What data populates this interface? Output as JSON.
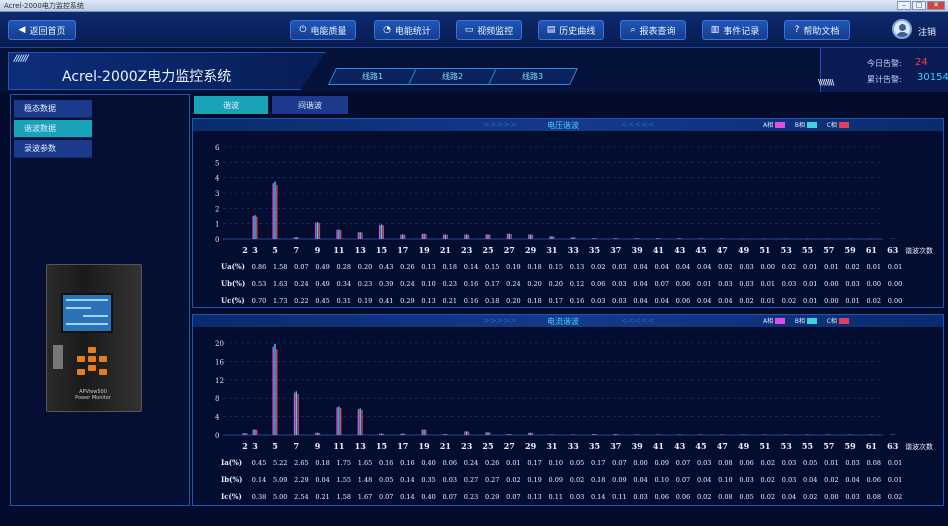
{
  "window": {
    "title": "Acrel-2000电力监控系统"
  },
  "nav": {
    "home": "返回首页",
    "items": [
      {
        "label": "电能质量",
        "icon": "power-quality-icon"
      },
      {
        "label": "电能统计",
        "icon": "statistics-icon"
      },
      {
        "label": "视频监控",
        "icon": "video-icon"
      },
      {
        "label": "历史曲线",
        "icon": "history-curve-icon"
      },
      {
        "label": "报表查询",
        "icon": "report-search-icon"
      },
      {
        "label": "事件记录",
        "icon": "event-record-icon"
      },
      {
        "label": "帮助文档",
        "icon": "help-icon"
      }
    ],
    "logout": "注销"
  },
  "header": {
    "title": "Acrel-2000Z电力监控系统",
    "lines": [
      "线路1",
      "线路2",
      "线路3"
    ]
  },
  "alarms": {
    "today_label": "今日告警:",
    "today_value": "24",
    "total_label": "累计告警:",
    "total_value": "30154"
  },
  "left_menu": [
    "稳态数据",
    "谐波数据",
    "录波参数"
  ],
  "left_menu_active": 1,
  "device": {
    "brand": "APView500",
    "name": "Power Monitor"
  },
  "right_tabs": [
    "谐波",
    "间谐波"
  ],
  "legend": {
    "a": "A相",
    "b": "B相",
    "c": "C相",
    "colors": {
      "a": "#e04de0",
      "b": "#3ad6e0",
      "c": "#e0405c"
    }
  },
  "xlabel_unit": "谐波次数",
  "orders": [
    "2",
    "3",
    "5",
    "7",
    "9",
    "11",
    "13",
    "15",
    "17",
    "19",
    "21",
    "23",
    "25",
    "27",
    "29",
    "31",
    "33",
    "35",
    "37",
    "39",
    "41",
    "43",
    "45",
    "47",
    "49",
    "51",
    "53",
    "55",
    "57",
    "59",
    "61",
    "63"
  ],
  "chart_data": [
    {
      "type": "bar",
      "title": "电压谐波",
      "xlabel": "谐波次数",
      "ylim": [
        0,
        6
      ],
      "yticks": [
        0,
        1,
        2,
        3,
        4,
        5,
        6
      ],
      "categories": [
        "2",
        "3",
        "5",
        "7",
        "9",
        "11",
        "13",
        "15",
        "17",
        "19",
        "21",
        "23",
        "25",
        "27",
        "29",
        "31",
        "33",
        "35",
        "37",
        "39",
        "41",
        "43",
        "45",
        "47",
        "49",
        "51",
        "53",
        "55",
        "57",
        "59",
        "61",
        "63"
      ],
      "series": [
        {
          "name": "A相",
          "row_label": "Ua(%)",
          "values": [
            0.86,
            1.58,
            0.07,
            0.49,
            0.28,
            0.2,
            0.43,
            0.26,
            0.13,
            0.18,
            0.14,
            0.15,
            0.19,
            0.18,
            0.15,
            0.13,
            0.02,
            0.03,
            0.04,
            0.04,
            0.04,
            0.04,
            0.02,
            0.03,
            0.0,
            0.02,
            0.01,
            0.01,
            0.02,
            0.01,
            0.01
          ]
        },
        {
          "name": "B相",
          "row_label": "Ub(%)",
          "values": [
            0.53,
            1.63,
            0.24,
            0.49,
            0.34,
            0.23,
            0.39,
            0.24,
            0.1,
            0.23,
            0.16,
            0.17,
            0.24,
            0.2,
            0.2,
            0.12,
            0.06,
            0.03,
            0.04,
            0.07,
            0.06,
            0.01,
            0.03,
            0.03,
            0.01,
            0.03,
            0.01,
            0.0,
            0.03,
            0.0,
            0.0
          ]
        },
        {
          "name": "C相",
          "row_label": "Uc(%)",
          "values": [
            0.7,
            1.73,
            0.22,
            0.45,
            0.31,
            0.19,
            0.41,
            0.29,
            0.13,
            0.21,
            0.16,
            0.18,
            0.2,
            0.18,
            0.17,
            0.16,
            0.03,
            0.03,
            0.04,
            0.04,
            0.06,
            0.04,
            0.04,
            0.02,
            0.01,
            0.02,
            0.01,
            0.0,
            0.01,
            0.02,
            0.0
          ]
        }
      ]
    },
    {
      "type": "bar",
      "title": "电流谐波",
      "xlabel": "谐波次数",
      "ylim": [
        0,
        20
      ],
      "yticks": [
        0,
        4,
        8,
        12,
        16,
        20
      ],
      "categories": [
        "2",
        "3",
        "5",
        "7",
        "9",
        "11",
        "13",
        "15",
        "17",
        "19",
        "21",
        "23",
        "25",
        "27",
        "29",
        "31",
        "33",
        "35",
        "37",
        "39",
        "41",
        "43",
        "45",
        "47",
        "49",
        "51",
        "53",
        "55",
        "57",
        "59",
        "61",
        "63"
      ],
      "series": [
        {
          "name": "A相",
          "row_label": "Ia(%)",
          "values": [
            0.45,
            5.22,
            2.65,
            0.18,
            1.75,
            1.65,
            0.16,
            0.16,
            0.4,
            0.06,
            0.24,
            0.26,
            0.01,
            0.17,
            0.1,
            0.05,
            0.17,
            0.07,
            0.0,
            0.09,
            0.07,
            0.03,
            0.08,
            0.06,
            0.02,
            0.03,
            0.05,
            0.01,
            0.03,
            0.08,
            0.01
          ]
        },
        {
          "name": "B相",
          "row_label": "Ib(%)",
          "values": [
            0.14,
            5.09,
            2.29,
            0.04,
            1.55,
            1.48,
            0.05,
            0.14,
            0.35,
            0.03,
            0.27,
            0.27,
            0.02,
            0.19,
            0.09,
            0.02,
            0.18,
            0.09,
            0.04,
            0.1,
            0.07,
            0.04,
            0.1,
            0.03,
            0.02,
            0.03,
            0.04,
            0.02,
            0.04,
            0.06,
            0.01
          ]
        },
        {
          "name": "C相",
          "row_label": "Ic(%)",
          "values": [
            0.38,
            5.0,
            2.54,
            0.21,
            1.58,
            1.67,
            0.07,
            0.14,
            0.4,
            0.07,
            0.23,
            0.29,
            0.07,
            0.13,
            0.11,
            0.03,
            0.14,
            0.11,
            0.03,
            0.06,
            0.06,
            0.02,
            0.08,
            0.05,
            0.02,
            0.04,
            0.02,
            0.0,
            0.03,
            0.08,
            0.02
          ]
        }
      ]
    }
  ],
  "bar_heights": {
    "voltage": [
      [
        0,
        1.55,
        3.75,
        0.12,
        1.1,
        0.62,
        0.45,
        0.95,
        0.3,
        0.35,
        0.3,
        0.3,
        0.3,
        0.35,
        0.3,
        0.18,
        0.1,
        0.05,
        0.05,
        0.05,
        0.05,
        0.05,
        0.03,
        0.03,
        0.02,
        0.02,
        0.02,
        0.02,
        0.02,
        0.02,
        0.02,
        0.02
      ]
    ],
    "current": [
      [
        0.4,
        1.2,
        19.8,
        9.5,
        0.5,
        6.2,
        5.8,
        0.3,
        0.3,
        1.2,
        0.2,
        0.8,
        0.6,
        0.2,
        0.5,
        0.1,
        0.1,
        0.2,
        0.2,
        0.1,
        0.1,
        0.1,
        0.1,
        0.1,
        0.1,
        0.1,
        0.1,
        0.1,
        0.1,
        0.1,
        0.1,
        0.1
      ]
    ]
  }
}
